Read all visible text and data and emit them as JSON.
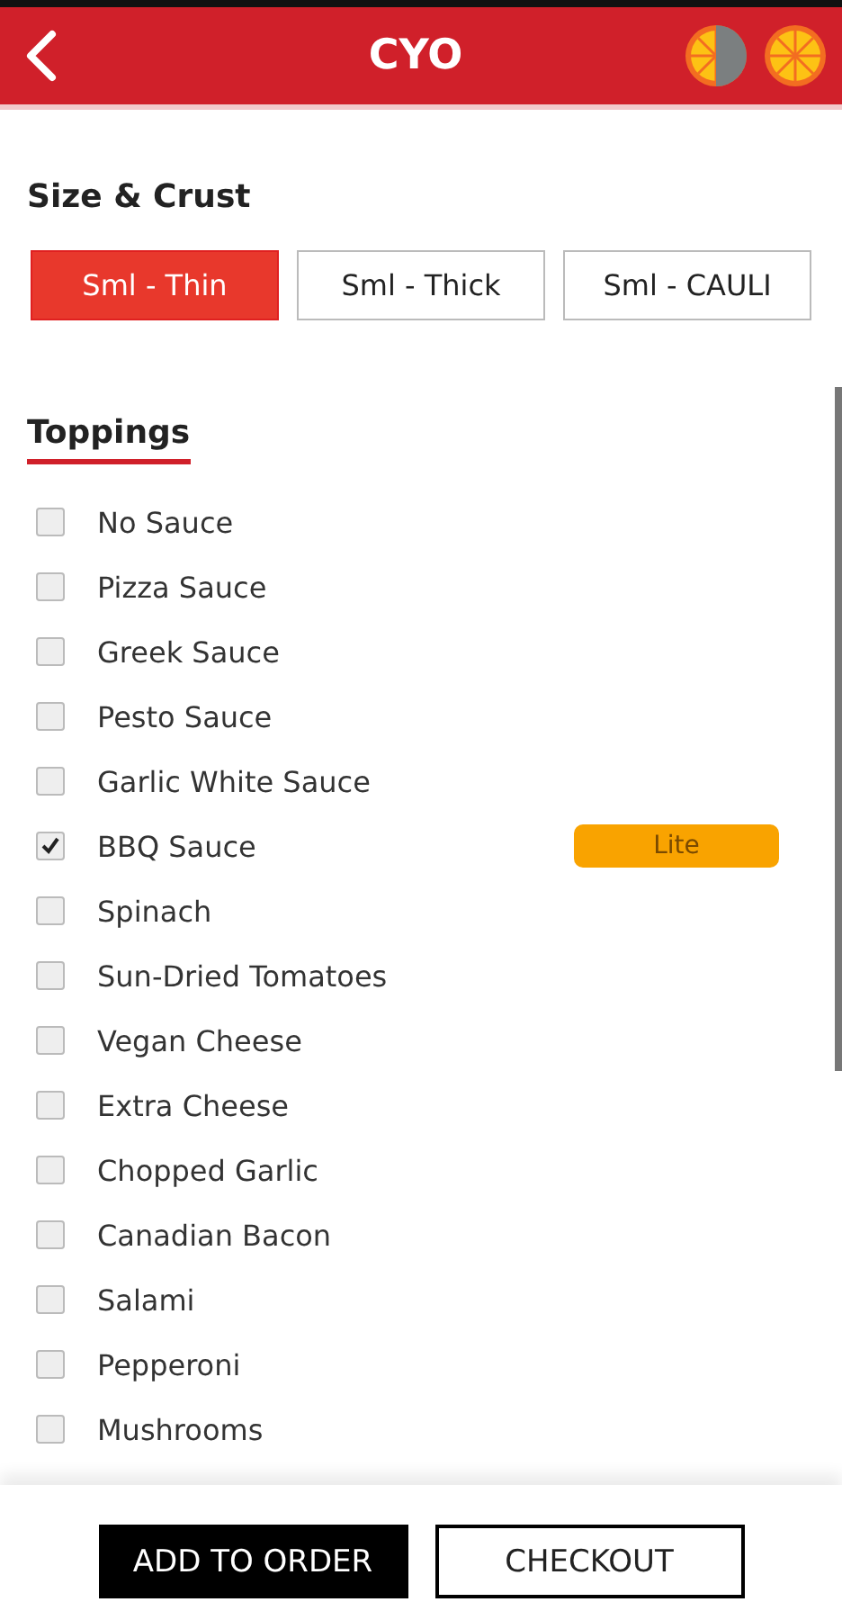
{
  "header": {
    "title": "CYO"
  },
  "size_crust": {
    "title": "Size & Crust",
    "options": [
      {
        "label": "Sml - Thin",
        "selected": true
      },
      {
        "label": "Sml - Thick",
        "selected": false
      },
      {
        "label": "Sml - CAULI",
        "selected": false
      }
    ]
  },
  "toppings": {
    "title": "Toppings",
    "items": [
      {
        "label": "No Sauce",
        "checked": false
      },
      {
        "label": "Pizza Sauce",
        "checked": false
      },
      {
        "label": "Greek Sauce",
        "checked": false
      },
      {
        "label": "Pesto Sauce",
        "checked": false
      },
      {
        "label": "Garlic White Sauce",
        "checked": false
      },
      {
        "label": "BBQ Sauce",
        "checked": true,
        "amount": "Lite"
      },
      {
        "label": "Spinach",
        "checked": false
      },
      {
        "label": "Sun-Dried Tomatoes",
        "checked": false
      },
      {
        "label": "Vegan Cheese",
        "checked": false
      },
      {
        "label": "Extra Cheese",
        "checked": false
      },
      {
        "label": "Chopped Garlic",
        "checked": false
      },
      {
        "label": "Canadian Bacon",
        "checked": false
      },
      {
        "label": "Salami",
        "checked": false
      },
      {
        "label": "Pepperoni",
        "checked": false
      },
      {
        "label": "Mushrooms",
        "checked": false
      }
    ]
  },
  "buttons": [
    {
      "label": "ADD TO ORDER",
      "kind": "primary"
    },
    {
      "label": "CHECKOUT",
      "kind": "secondary"
    }
  ]
}
